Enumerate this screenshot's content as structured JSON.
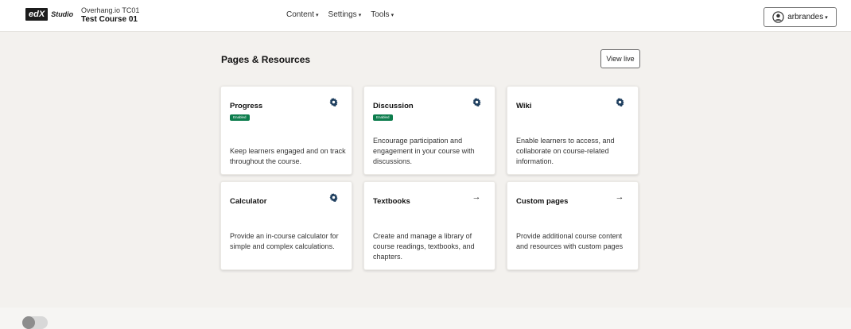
{
  "header": {
    "logo_box": "edX",
    "logo_text": "Studio",
    "course_org": "Overhang.io TC01",
    "course_name": "Test Course 01",
    "nav": [
      {
        "label": "Content"
      },
      {
        "label": "Settings"
      },
      {
        "label": "Tools"
      }
    ],
    "user": "arbrandes",
    "user_icon": "user-circle-icon"
  },
  "main": {
    "title": "Pages & Resources",
    "view_live": "View live",
    "cards": [
      {
        "title": "Progress",
        "badge": "Enabled",
        "desc": "Keep learners engaged and on track throughout the course.",
        "icon": "gear-icon"
      },
      {
        "title": "Discussion",
        "badge": "Enabled",
        "desc": "Encourage participation and engagement in your course with discussions.",
        "icon": "gear-icon"
      },
      {
        "title": "Wiki",
        "desc": "Enable learners to access, and collaborate on course-related information.",
        "icon": "gear-icon"
      },
      {
        "title": "Calculator",
        "desc": "Provide an in-course calculator for simple and complex calculations.",
        "icon": "gear-icon"
      },
      {
        "title": "Textbooks",
        "desc": "Create and manage a library of course readings, textbooks, and chapters.",
        "icon": "arrow-right-icon"
      },
      {
        "title": "Custom pages",
        "desc": "Provide additional course content and resources with custom pages",
        "icon": "arrow-right-icon"
      }
    ]
  },
  "footer": {
    "toggle": "off"
  }
}
